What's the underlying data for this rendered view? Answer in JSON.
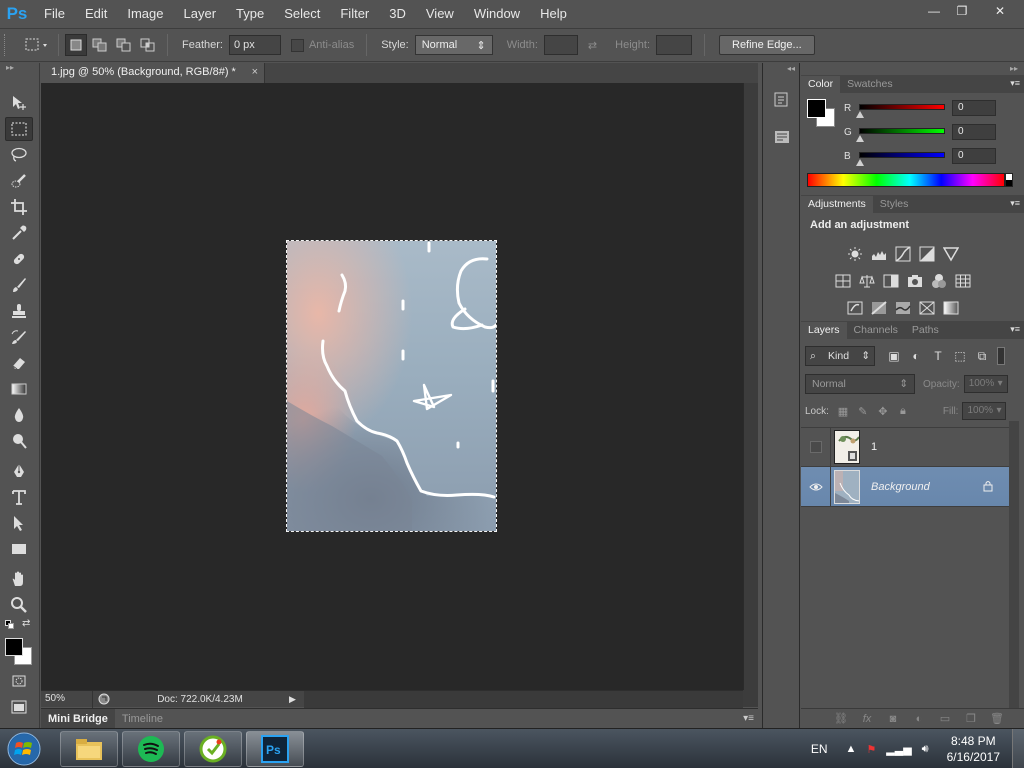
{
  "app": {
    "logo": "Ps"
  },
  "menu": [
    "File",
    "Edit",
    "Image",
    "Layer",
    "Type",
    "Select",
    "Filter",
    "3D",
    "View",
    "Window",
    "Help"
  ],
  "window_controls": {
    "minimize": "—",
    "restore": "❐",
    "close": "✕"
  },
  "options_bar": {
    "feather_label": "Feather:",
    "feather_value": "0 px",
    "antialias_label": "Anti-alias",
    "style_label": "Style:",
    "style_value": "Normal",
    "width_label": "Width:",
    "height_label": "Height:",
    "refine_edge": "Refine Edge..."
  },
  "document": {
    "tab_title": "1.jpg @ 50% (Background, RGB/8#) *",
    "tab_close": "×"
  },
  "status_bar": {
    "zoom": "50%",
    "doc_info": "Doc: 722.0K/4.23M",
    "arrow": "▶"
  },
  "bottom_tabs": [
    "Mini Bridge",
    "Timeline"
  ],
  "color_panel": {
    "tabs": [
      "Color",
      "Swatches"
    ],
    "sliders": [
      {
        "label": "R",
        "value": "0",
        "gradient": "#ff0000"
      },
      {
        "label": "G",
        "value": "0",
        "gradient": "#00ff00"
      },
      {
        "label": "B",
        "value": "0",
        "gradient": "#0000ff"
      }
    ]
  },
  "adjustments_panel": {
    "tabs": [
      "Adjustments",
      "Styles"
    ],
    "title": "Add an adjustment"
  },
  "layers_panel": {
    "tabs": [
      "Layers",
      "Channels",
      "Paths"
    ],
    "kind_label": "Kind",
    "blend_mode": "Normal",
    "opacity_label": "Opacity:",
    "opacity_value": "100%",
    "lock_label": "Lock:",
    "fill_label": "Fill:",
    "fill_value": "100%",
    "layers": [
      {
        "name": "1",
        "visible": false,
        "selected": false
      },
      {
        "name": "Background",
        "visible": true,
        "selected": true,
        "locked": true
      }
    ]
  },
  "taskbar": {
    "language": "EN",
    "time": "8:48 PM",
    "date": "6/16/2017",
    "apps": [
      "file-explorer",
      "spotify",
      "green-app",
      "photoshop"
    ]
  },
  "colors": {
    "accent": "#2aa2f2",
    "selected_layer": "#6f8db1",
    "canvas_bg": "#282828",
    "panel_bg": "#535353"
  }
}
